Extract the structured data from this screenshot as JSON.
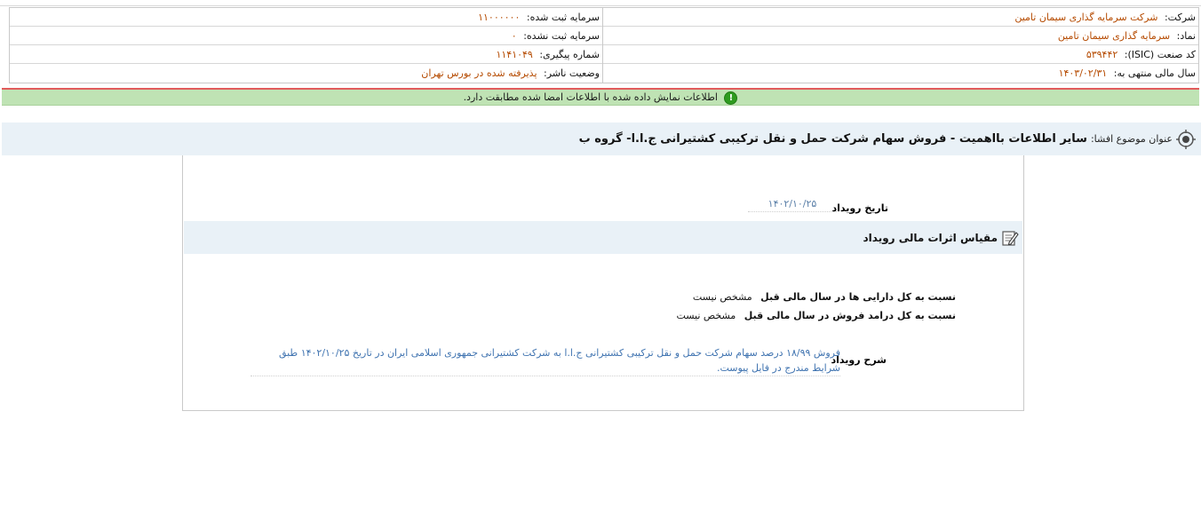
{
  "header": {
    "company_label": "شرکت:",
    "company_value": "شرکت سرمایه گذاری سیمان تامین",
    "symbol_label": "نماد:",
    "symbol_value": "سرمایه گذاری سیمان تامین",
    "isic_label": "کد صنعت (ISIC):",
    "isic_value": "۵۳۹۴۴۲",
    "fiscal_label": "سال مالی منتهی به:",
    "fiscal_value": "۱۴۰۳/۰۲/۳۱",
    "reg_capital_label": "سرمایه ثبت شده:",
    "reg_capital_value": "۱۱۰۰۰۰۰۰",
    "unreg_capital_label": "سرمایه ثبت نشده:",
    "unreg_capital_value": "۰",
    "tracking_label": "شماره پیگیری:",
    "tracking_value": "۱۱۴۱۰۴۹",
    "publisher_label": "وضعیت ناشر:",
    "publisher_value": "پذیرفته شده در بورس تهران"
  },
  "message": {
    "text": "اطلاعات نمایش داده شده با اطلاعات امضا شده مطابقت دارد.",
    "icon": "info-icon"
  },
  "title": {
    "label": "عنوان موضوع افشا:",
    "text": "سایر اطلاعات بااهمیت - فروش سهام شرکت حمل و نقل ترکیبی کشتیرانی ج.ا.ا- گروه ب"
  },
  "event": {
    "date_label": "تاریخ رویداد",
    "date_value": "۱۴۰۲/۱۰/۲۵",
    "section_title": "مقیاس اثرات مالی رویداد",
    "ratio_assets_label": "نسبت به کل دارایی ها در سال مالی قبل",
    "ratio_assets_value": "مشخص نیست",
    "ratio_revenue_label": "نسبت به کل درامد فروش در سال مالی قبل",
    "ratio_revenue_value": "مشخص نیست",
    "desc_label": "شرح رویداد",
    "desc_value": "فروش ۱۸/۹۹ درصد سهام شرکت حمل و نقل ترکیبی کشتیرانی ج.ا.ا به شرکت کشتیرانی جمهوری اسلامی ایران در تاریخ ۱۴۰۲/۱۰/۲۵ طبق شرایط مندرج در فایل پیوست."
  },
  "colors": {
    "value_text": "#b54a00",
    "link_text": "#3f73b0",
    "message_bg": "#bfe3b4",
    "title_bg": "#e9f1f7",
    "divider_red": "#e15b5b"
  }
}
